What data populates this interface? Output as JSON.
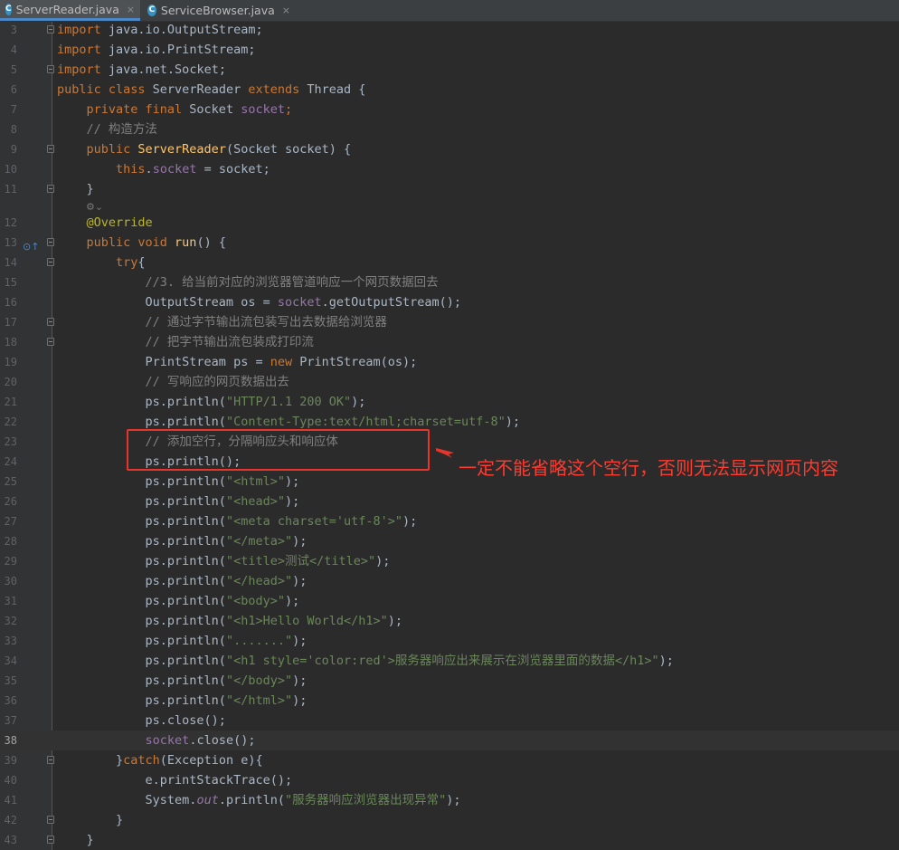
{
  "tabs": [
    {
      "label": "ServerReader.java",
      "active": true,
      "icon": "java-class-icon"
    },
    {
      "label": "ServiceBrowser.java",
      "active": false,
      "icon": "java-class-icon"
    }
  ],
  "tab_close_glyph": "×",
  "class_icon_letter": "C",
  "current_line": "38",
  "annotation": {
    "callout": "一定不能省略这个空行，否则无法显示网页内容",
    "color": "#e8352b"
  },
  "code": {
    "l3": {
      "num": "3",
      "a": "import",
      "b": " java.io.OutputStream;"
    },
    "l4": {
      "num": "4",
      "a": "import",
      "b": " java.io.PrintStream;"
    },
    "l5": {
      "num": "5",
      "a": "import",
      "b": " java.net.Socket;"
    },
    "l6": {
      "num": "6",
      "a": "public class",
      "b": " ServerReader ",
      "c": "extends",
      "d": " Thread {"
    },
    "l7": {
      "num": "7",
      "a": "    private final",
      "b": " Socket ",
      "c": "socket",
      "d": ";"
    },
    "l8": {
      "num": "8",
      "a": "    // 构造方法"
    },
    "l9": {
      "num": "9",
      "a": "    public",
      "b": " ServerReader",
      "c": "(Socket socket) {"
    },
    "l10": {
      "num": "10",
      "a": "        this",
      "b": ".",
      "c": "socket",
      "d": " = socket;"
    },
    "l11": {
      "num": "11",
      "a": "    }"
    },
    "l11b": {
      "hint": "⚙⌄"
    },
    "l12": {
      "num": "12",
      "a": "    @Override"
    },
    "l13": {
      "num": "13",
      "a": "    public void",
      "b": " run",
      "c": "() {"
    },
    "l14": {
      "num": "14",
      "a": "        try",
      "b": "{"
    },
    "l15": {
      "num": "15",
      "a": "            //3. 给当前对应的浏览器管道响应一个网页数据回去"
    },
    "l16": {
      "num": "16",
      "a": "            OutputStream os = ",
      "b": "socket",
      "c": ".getOutputStream();"
    },
    "l17": {
      "num": "17",
      "a": "            // 通过字节输出流包装写出去数据给浏览器"
    },
    "l18": {
      "num": "18",
      "a": "            // 把字节输出流包装成打印流"
    },
    "l19": {
      "num": "19",
      "a": "            PrintStream ps = ",
      "b": "new",
      "c": " PrintStream(os);"
    },
    "l20": {
      "num": "20",
      "a": "            // 写响应的网页数据出去"
    },
    "l21": {
      "num": "21",
      "a": "            ps.println(",
      "b": "\"HTTP/1.1 200 OK\"",
      "c": ");"
    },
    "l22": {
      "num": "22",
      "a": "            ps.println(",
      "b": "\"Content-Type:text/html;charset=utf-8\"",
      "c": ");"
    },
    "l23": {
      "num": "23",
      "a": "            // 添加空行，分隔响应头和响应体"
    },
    "l24": {
      "num": "24",
      "a": "            ps.println();"
    },
    "l25": {
      "num": "25",
      "a": "            ps.println(",
      "b": "\"<html>\"",
      "c": ");"
    },
    "l26": {
      "num": "26",
      "a": "            ps.println(",
      "b": "\"<head>\"",
      "c": ");"
    },
    "l27": {
      "num": "27",
      "a": "            ps.println(",
      "b": "\"<meta charset='utf-8'>\"",
      "c": ");"
    },
    "l28": {
      "num": "28",
      "a": "            ps.println(",
      "b": "\"</meta>\"",
      "c": ");"
    },
    "l29": {
      "num": "29",
      "a": "            ps.println(",
      "b": "\"<title>测试</title>\"",
      "c": ");"
    },
    "l30": {
      "num": "30",
      "a": "            ps.println(",
      "b": "\"</head>\"",
      "c": ");"
    },
    "l31": {
      "num": "31",
      "a": "            ps.println(",
      "b": "\"<body>\"",
      "c": ");"
    },
    "l32": {
      "num": "32",
      "a": "            ps.println(",
      "b": "\"<h1>Hello World</h1>\"",
      "c": ");"
    },
    "l33": {
      "num": "33",
      "a": "            ps.println(",
      "b": "\".......\"",
      "c": ");"
    },
    "l34": {
      "num": "34",
      "a": "            ps.println(",
      "b": "\"<h1 style='color:red'>服务器响应出来展示在浏览器里面的数据</h1>\"",
      "c": ");"
    },
    "l35": {
      "num": "35",
      "a": "            ps.println(",
      "b": "\"</body>\"",
      "c": ");"
    },
    "l36": {
      "num": "36",
      "a": "            ps.println(",
      "b": "\"</html>\"",
      "c": ");"
    },
    "l37": {
      "num": "37",
      "a": "            ps.close();"
    },
    "l38": {
      "num": "38",
      "a": "            ",
      "b": "socket",
      "c": ".close();"
    },
    "l39": {
      "num": "39",
      "a": "        }",
      "b": "catch",
      "c": "(Exception e){"
    },
    "l40": {
      "num": "40",
      "a": "            e.printStackTrace();"
    },
    "l41": {
      "num": "41",
      "a": "            System.",
      "b": "out",
      "c": ".println(",
      "d": "\"服务器响应浏览器出现异常\"",
      "e": ");"
    },
    "l42": {
      "num": "42",
      "a": "        }"
    },
    "l43": {
      "num": "43",
      "a": "    }"
    }
  }
}
